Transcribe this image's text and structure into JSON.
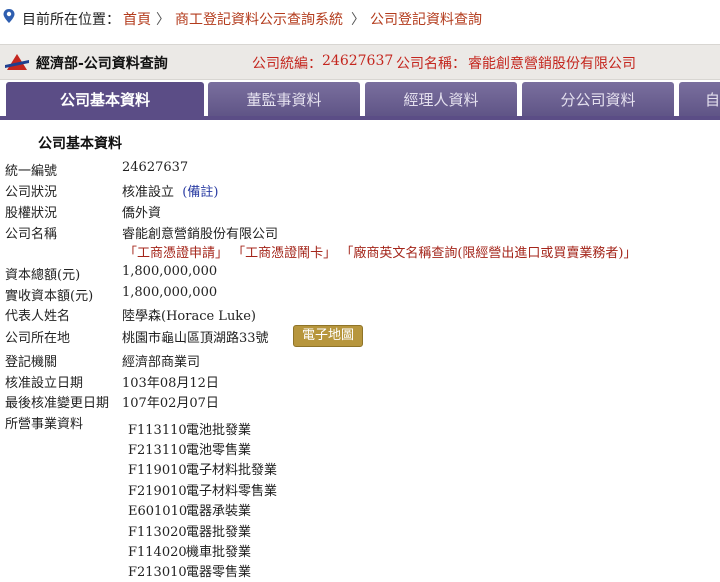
{
  "breadcrumb": {
    "here_label": "目前所在位置：",
    "items": [
      "首頁",
      "商工登記資料公示查詢系統",
      "公司登記資料查詢"
    ],
    "separator": "〉"
  },
  "header": {
    "department": "經濟部-公司資料查詢",
    "ban_label": "公司統編：",
    "ban": "24627637",
    "name_label": "公司名稱：",
    "name": "睿能創意營銷股份有限公司"
  },
  "tabs": [
    {
      "label": "公司基本資料",
      "active": true
    },
    {
      "label": "董監事資料",
      "active": false
    },
    {
      "label": "經理人資料",
      "active": false
    },
    {
      "label": "分公司資料",
      "active": false
    },
    {
      "label": "自",
      "active": false
    }
  ],
  "section_title": "公司基本資料",
  "fields": {
    "ban": {
      "label": "統一編號",
      "value": "24627637"
    },
    "status": {
      "label": "公司狀況",
      "value": "核准設立",
      "note": "(備註)"
    },
    "ownership": {
      "label": "股權狀況",
      "value": "僑外資"
    },
    "name": {
      "label": "公司名稱",
      "value": "睿能創意營銷股份有限公司"
    },
    "capital": {
      "label": "資本總額(元)",
      "value": "1,800,000,000"
    },
    "paid_in": {
      "label": "實收資本額(元)",
      "value": "1,800,000,000"
    },
    "rep": {
      "label": "代表人姓名",
      "value": "陸學森(Horace Luke)"
    },
    "address": {
      "label": "公司所在地",
      "value": "桃園市龜山區頂湖路33號"
    },
    "authority": {
      "label": "登記機關",
      "value": "經濟部商業司"
    },
    "approved": {
      "label": "核准設立日期",
      "value": "103年08月12日"
    },
    "changed": {
      "label": "最後核准變更日期",
      "value": "107年02月07日"
    },
    "business": {
      "label": "所營事業資料"
    }
  },
  "query_links": [
    "「工商憑證申請」",
    "「工商憑證鬧卡」",
    "「廠商英文名稱查詢(限經營出進口或買賣業務者)」"
  ],
  "map_button": "電子地圖",
  "business_items": [
    {
      "code": "F113110",
      "name": "電池批發業"
    },
    {
      "code": "F213110",
      "name": "電池零售業"
    },
    {
      "code": "F119010",
      "name": "電子材料批發業"
    },
    {
      "code": "F219010",
      "name": "電子材料零售業"
    },
    {
      "code": "E601010",
      "name": "電器承裝業"
    },
    {
      "code": "F113020",
      "name": "電器批發業"
    },
    {
      "code": "F114020",
      "name": "機車批發業"
    },
    {
      "code": "F213010",
      "name": "電器零售業"
    }
  ],
  "colors": {
    "tab_active": "#5b4d86",
    "header_red": "#c4261e",
    "link_red": "#b33b1c",
    "map_button": "#b7963d"
  }
}
